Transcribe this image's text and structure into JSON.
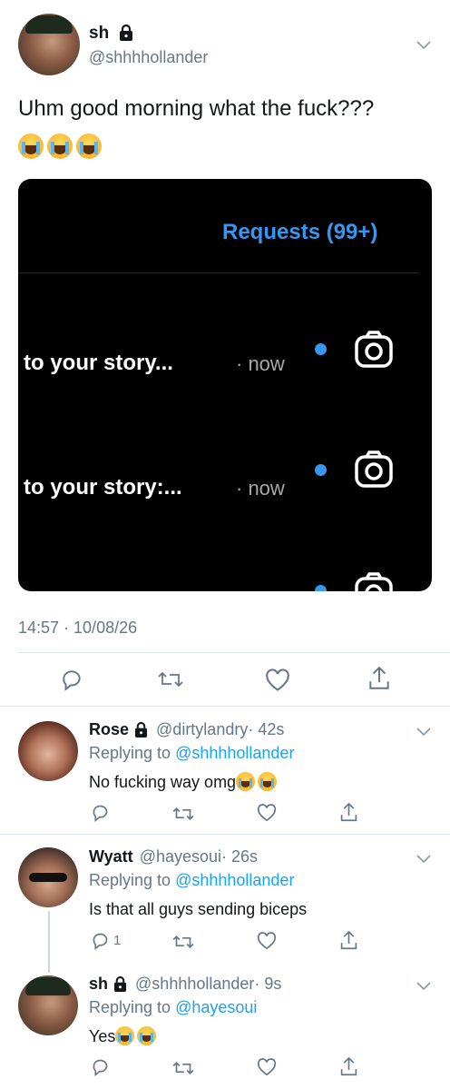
{
  "tweet": {
    "display_name": "sh",
    "handle": "@shhhhollander",
    "text": "Uhm good morning what the fuck???",
    "emoji_count": 3,
    "timestamp": "14:57 · 10/08/26",
    "media": {
      "requests_label": "Requests (99+)",
      "rows": [
        {
          "text": "to your story...",
          "time": "· now"
        },
        {
          "text": "to your story:...",
          "time": "· now"
        }
      ]
    }
  },
  "replies": [
    {
      "name": "Rose",
      "locked": true,
      "handle": "@dirtylandry",
      "time": "· 42s",
      "replying_prefix": "Replying to",
      "replying_to": "@shhhhollander",
      "text": "No fucking way omg",
      "reply_count": ""
    },
    {
      "name": "Wyatt",
      "locked": false,
      "handle": "@hayesoui",
      "time": "· 26s",
      "replying_prefix": "Replying to",
      "replying_to": "@shhhhollander",
      "text": "Is that all guys sending biceps",
      "reply_count": "1"
    },
    {
      "name": "sh",
      "locked": true,
      "handle": "@shhhhollander",
      "time": "· 9s",
      "replying_prefix": "Replying to",
      "replying_to": "@hayesoui",
      "text": "Yes",
      "reply_count": ""
    }
  ],
  "colors": {
    "accent": "#1da1f2",
    "muted": "#657786",
    "divider": "#e1e8ed",
    "ig_blue": "#3797f0"
  }
}
